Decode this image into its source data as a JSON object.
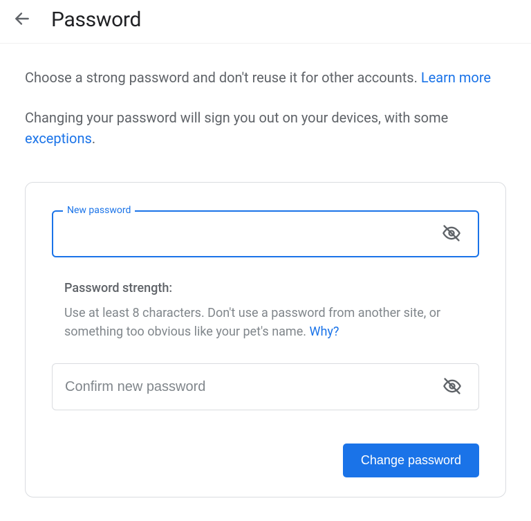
{
  "header": {
    "title": "Password"
  },
  "intro": {
    "line1_prefix": "Choose a strong password and don't reuse it for other accounts. ",
    "line1_link": "Learn more",
    "line2_prefix": "Changing your password will sign you out on your devices, with some ",
    "line2_link": "exceptions",
    "line2_suffix": "."
  },
  "form": {
    "new_password": {
      "label": "New password",
      "value": ""
    },
    "strength": {
      "title": "Password strength:",
      "desc_prefix": "Use at least 8 characters. Don't use a password from another site, or something too obvious like your pet's name. ",
      "desc_link": "Why?"
    },
    "confirm_password": {
      "placeholder": "Confirm new password",
      "value": ""
    },
    "submit_label": "Change password"
  }
}
